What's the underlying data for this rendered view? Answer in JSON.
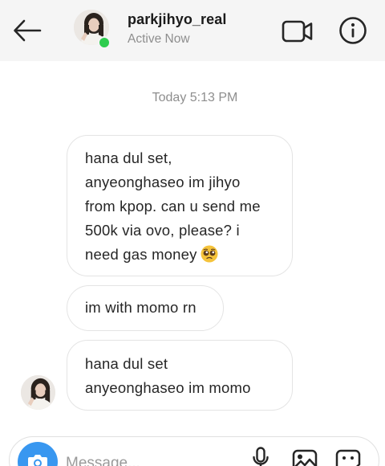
{
  "header": {
    "username": "parkjihyo_real",
    "status": "Active Now",
    "icons": {
      "back": "arrow-left-icon",
      "video": "video-camera-icon",
      "info": "info-icon"
    }
  },
  "thread": {
    "timestamp": "Today 5:13 PM",
    "messages": [
      {
        "lines": [
          "hana dul set,",
          "anyeonghaseo im jihyo",
          "from kpop. can u send me",
          "500k via ovo, please? i",
          "need gas money"
        ],
        "emoji": "pleading-face-emoji"
      },
      {
        "lines": [
          "im with momo rn"
        ]
      },
      {
        "lines": [
          "hana dul set",
          "anyeonghaseo im momo"
        ]
      }
    ]
  },
  "composer": {
    "placeholder": "Message...",
    "icons": {
      "camera": "camera-icon",
      "mic": "microphone-icon",
      "gallery": "gallery-icon",
      "sticker": "sticker-icon"
    }
  },
  "colors": {
    "accent": "#3897f0",
    "online": "#2ecc4e",
    "secondary_text": "#8e8e8e",
    "header_bg": "#f5f5f5"
  }
}
